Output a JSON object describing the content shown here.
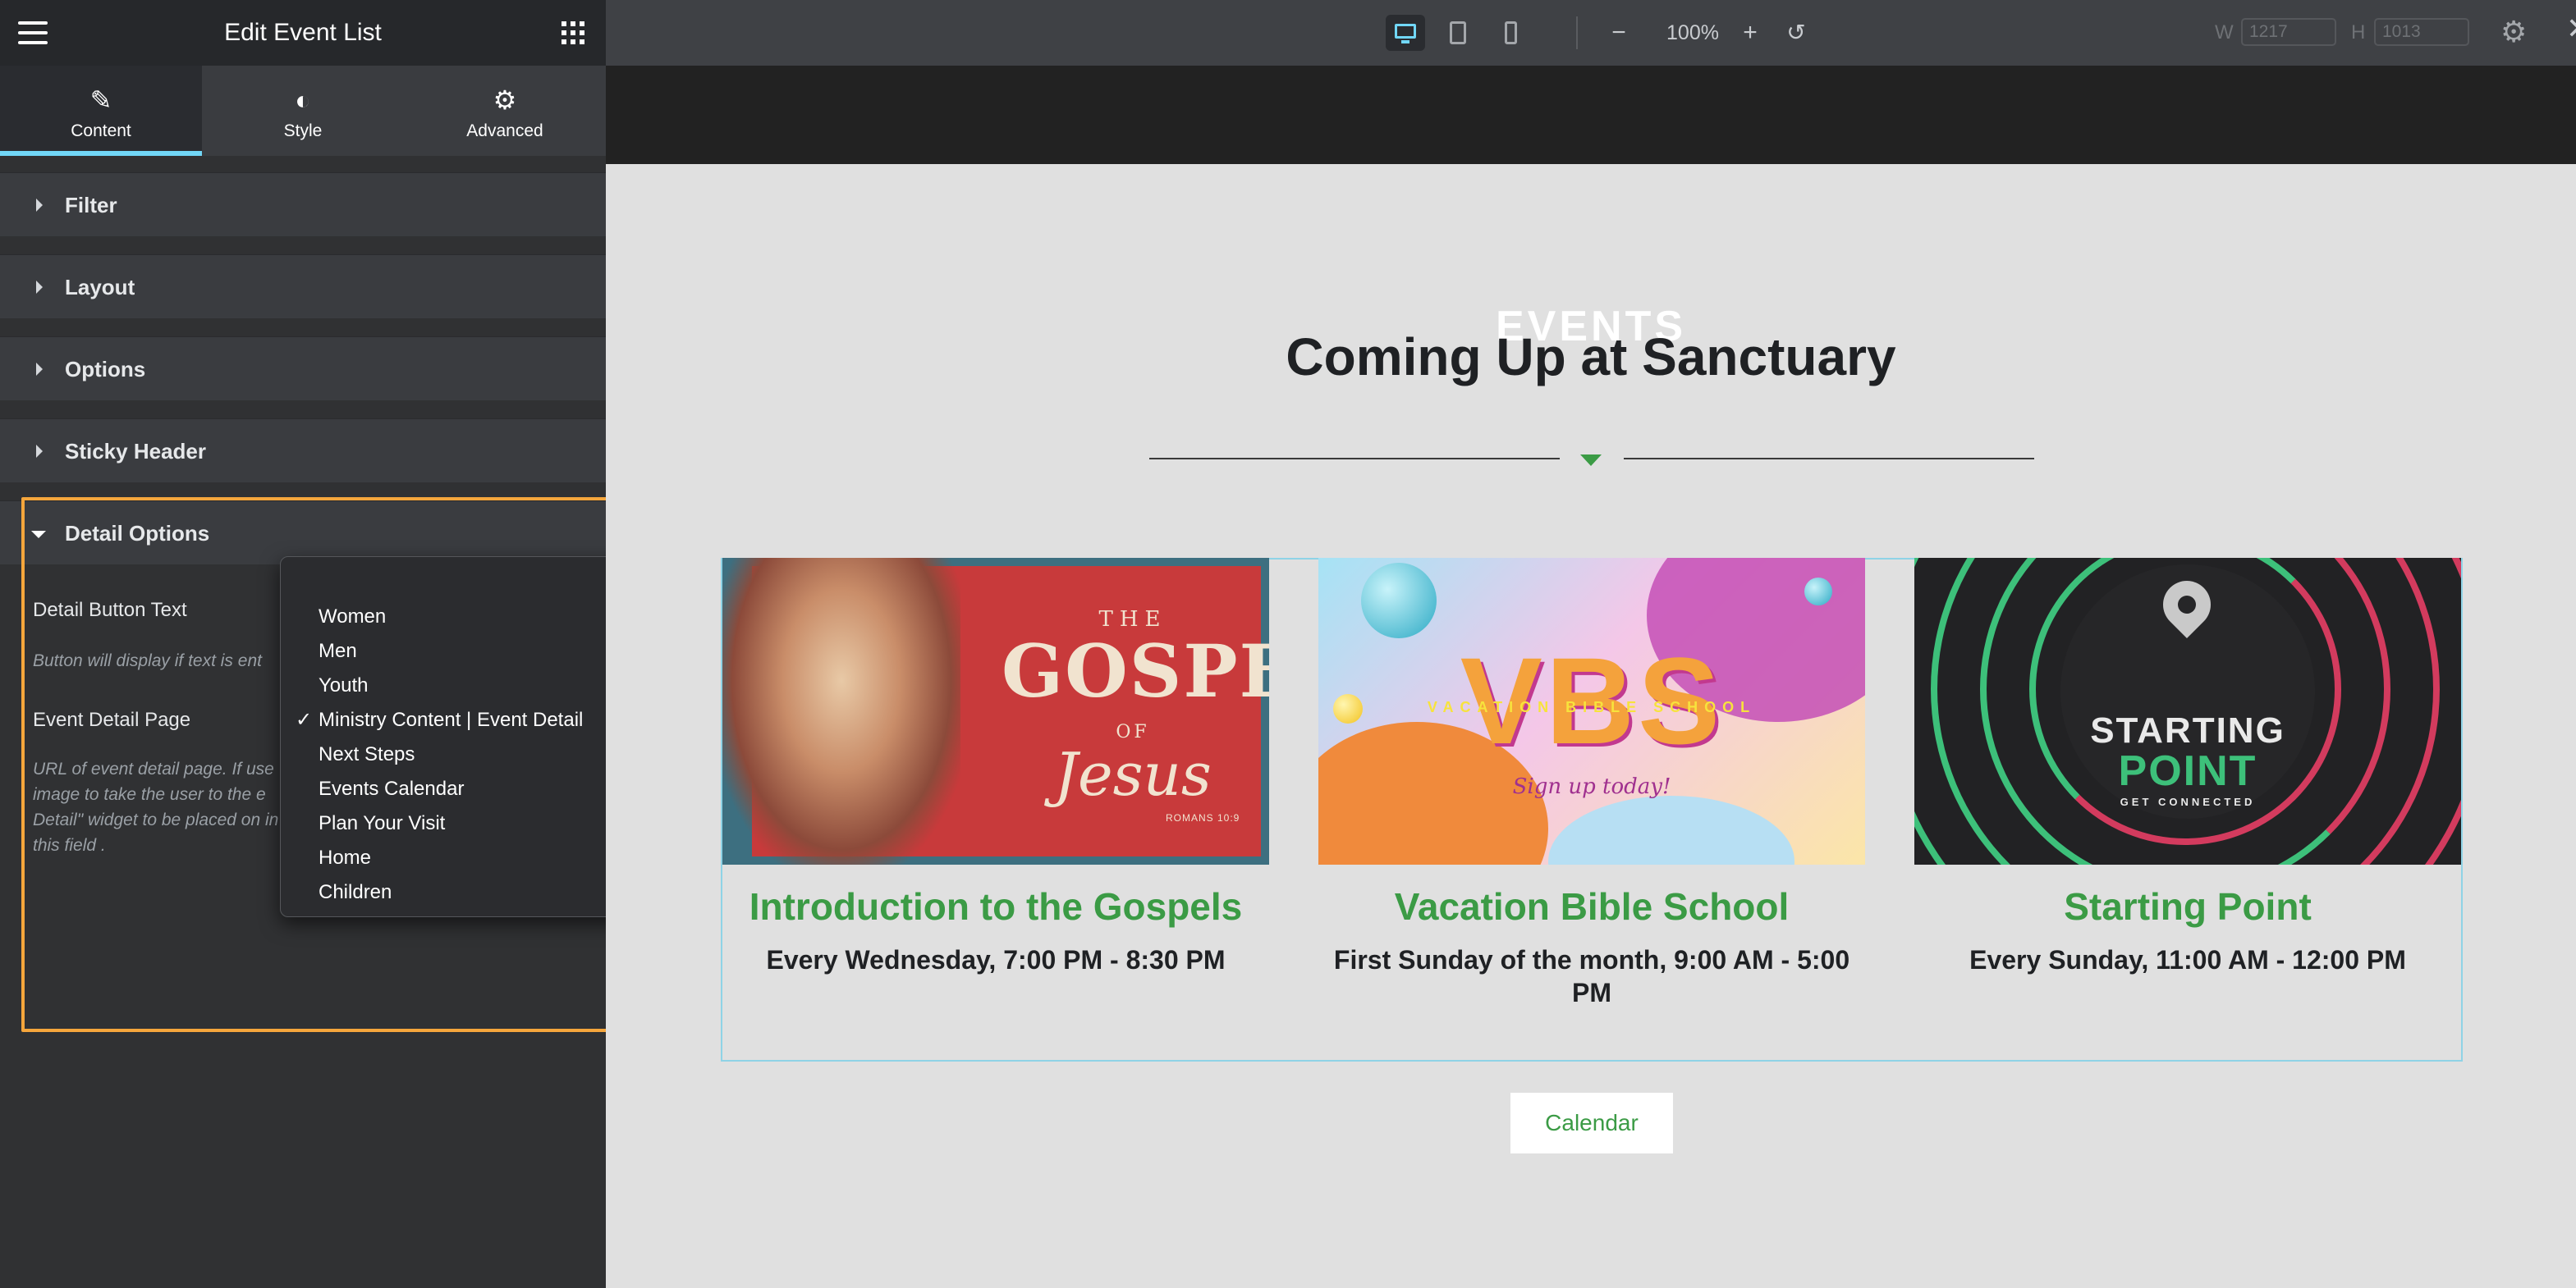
{
  "sidebar": {
    "title": "Edit Event List",
    "tabs": [
      {
        "label": "Content",
        "icon": "pencil-icon"
      },
      {
        "label": "Style",
        "icon": "half-circle-icon"
      },
      {
        "label": "Advanced",
        "icon": "gear-icon"
      }
    ],
    "sections": [
      {
        "label": "Filter"
      },
      {
        "label": "Layout"
      },
      {
        "label": "Options"
      },
      {
        "label": "Sticky Header"
      },
      {
        "label": "Detail Options"
      }
    ],
    "detail_options": {
      "button_text_label": "Detail Button Text",
      "button_text_desc": "Button will display if text is ent",
      "event_page_label": "Event Detail Page",
      "event_page_desc": "URL of event detail page. If use image to take the user to the e Detail\" widget to be placed on in this field ."
    }
  },
  "dropdown": {
    "selected": "Ministry Content | Event Detail",
    "options": [
      "Women",
      "Men",
      "Youth",
      "Ministry Content | Event Detail",
      "Next Steps",
      "Events Calendar",
      "Plan Your Visit",
      "Home",
      "Children"
    ]
  },
  "toolbar": {
    "zoom": "100%",
    "width_label": "W",
    "width_value": "1217",
    "height_label": "H",
    "height_value": "1013",
    "minus": "−",
    "plus": "+",
    "undo": "↺",
    "settings": "⚙",
    "close": "✕"
  },
  "page": {
    "eyebrow": "EVENTS",
    "heading": "Coming Up at Sanctuary",
    "events": [
      {
        "title": "Introduction to the Gospels",
        "date": "Every Wednesday, 7:00 PM - 8:30 PM",
        "image": {
          "line1": "THE",
          "line2": "GOSPEL",
          "line3": "OF",
          "line4": "Jesus",
          "line5": "ROMANS 10:9"
        }
      },
      {
        "title": "Vacation Bible School",
        "date": "First Sunday of the month, 9:00 AM - 5:00 PM",
        "image": {
          "line1": "VBS",
          "line2": "VACATION BIBLE SCHOOL",
          "line3": "Sign up today!"
        }
      },
      {
        "title": "Starting Point",
        "date": "Every Sunday, 11:00 AM - 12:00 PM",
        "image": {
          "line1": "STARTING",
          "line2": "POINT",
          "line3": "GET CONNECTED"
        }
      }
    ],
    "calendar_button": "Calendar"
  },
  "colors": {
    "accent_green": "#3b9b45",
    "editor_accent": "#71d7f7",
    "highlight_orange": "#f5a63c"
  }
}
